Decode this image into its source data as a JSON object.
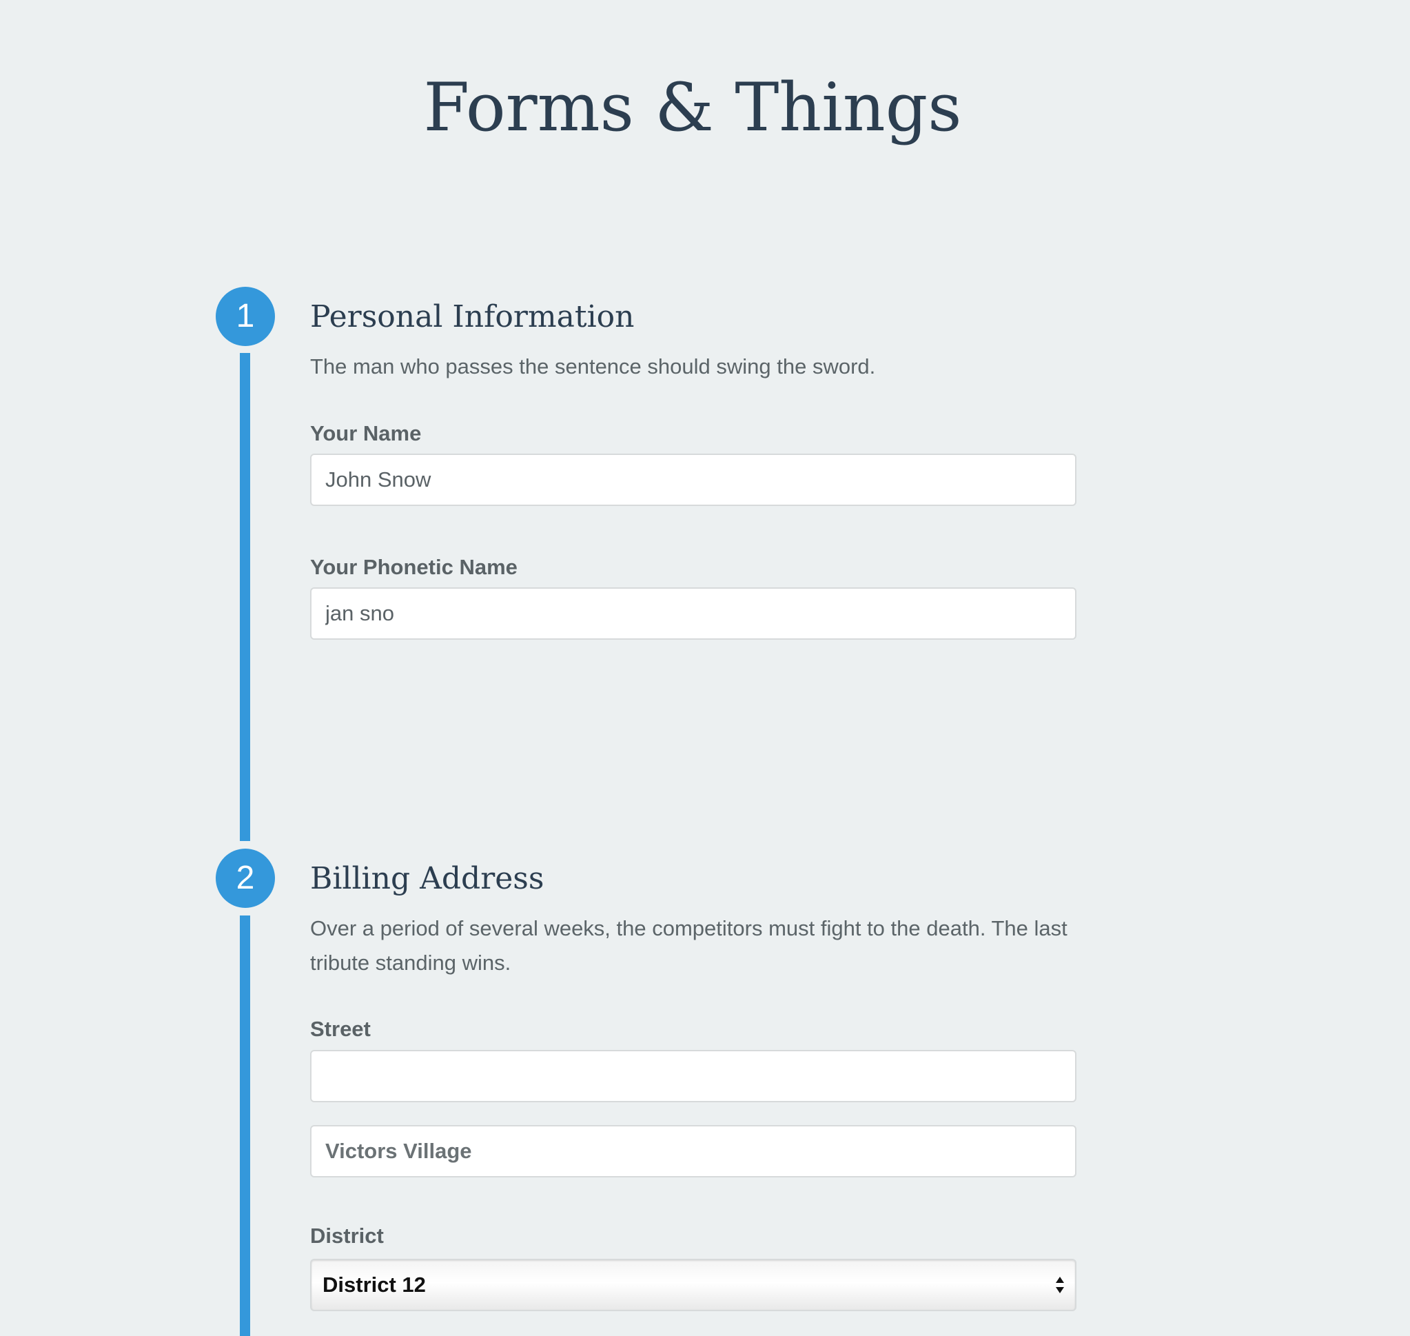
{
  "page": {
    "title": "Forms & Things"
  },
  "sections": [
    {
      "step_number": "1",
      "heading": "Personal Information",
      "description": "The man who passes the sentence should swing the sword.",
      "fields": [
        {
          "label": "Your Name",
          "value": "",
          "placeholder": "John Snow"
        },
        {
          "label": "Your Phonetic Name",
          "value": "",
          "placeholder": "jan sno"
        }
      ]
    },
    {
      "step_number": "2",
      "heading": "Billing Address",
      "description": "Over a period of several weeks, the competitors must fight to the death. The last tribute standing wins.",
      "street": {
        "label": "Street",
        "line1_value": "",
        "line1_placeholder": "",
        "line2_value": "",
        "line2_placeholder": "Victors Village"
      },
      "district": {
        "label": "District",
        "selected": "District 12"
      }
    }
  ],
  "colors": {
    "accent": "#3498db",
    "background": "#ecf0f1",
    "heading": "#2c3e50",
    "body_text": "#5a6266"
  },
  "icons": {
    "select_arrow": "updown-chevron-icon"
  }
}
